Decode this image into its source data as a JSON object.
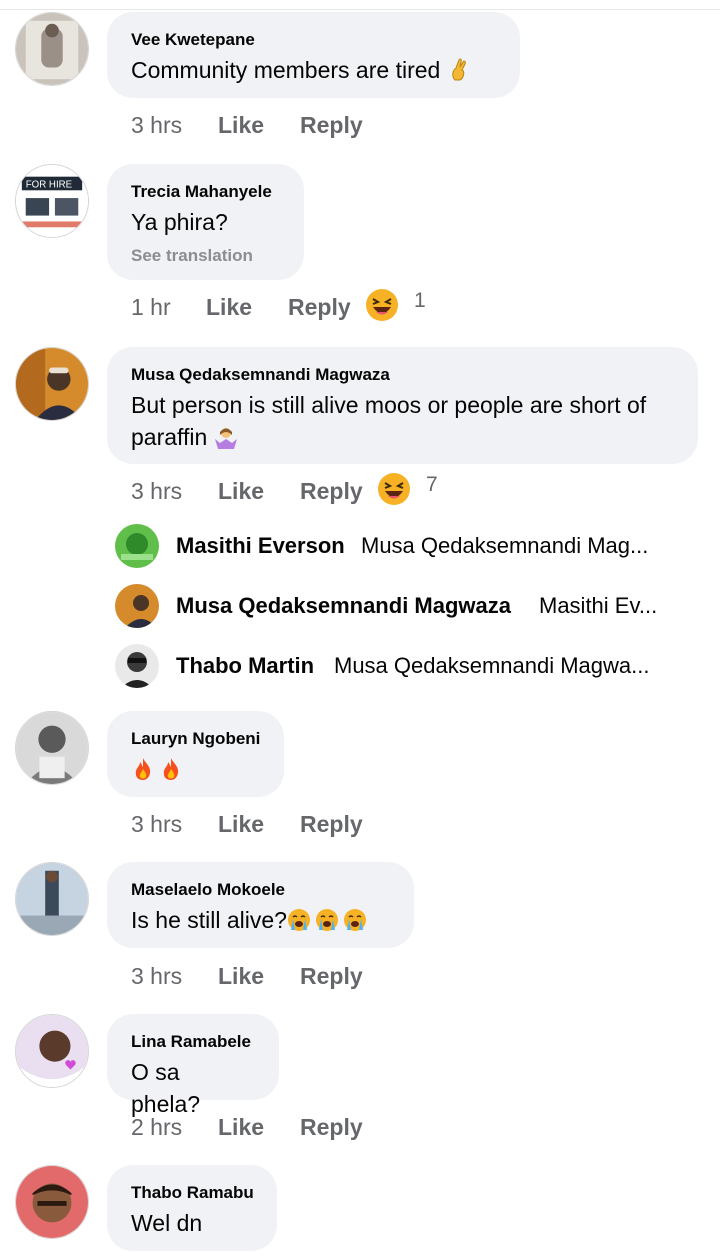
{
  "comments": [
    {
      "author": "Vee Kwetepane",
      "text": "Community members are tired",
      "time": "3 hrs",
      "like_label": "Like",
      "reply_label": "Reply"
    },
    {
      "author": "Trecia Mahanyele",
      "text": "Ya phira?",
      "see_translation": "See translation",
      "time": "1 hr",
      "like_label": "Like",
      "reply_label": "Reply",
      "reaction_count": "1"
    },
    {
      "author": "Musa Qedaksemnandi Magwaza",
      "text_line1": "But person is still alive moos or people are short of",
      "text_line2": "paraffin",
      "time": "3 hrs",
      "like_label": "Like",
      "reply_label": "Reply",
      "reaction_count": "7",
      "replies": [
        {
          "name": "Masithi Everson",
          "text": "Musa Qedaksemnandi Mag..."
        },
        {
          "name": "Musa Qedaksemnandi Magwaza",
          "text": "Masithi Ev..."
        },
        {
          "name": "Thabo Martin",
          "text": "Musa Qedaksemnandi Magwa..."
        }
      ]
    },
    {
      "author": "Lauryn Ngobeni",
      "time": "3 hrs",
      "like_label": "Like",
      "reply_label": "Reply"
    },
    {
      "author": "Maselaelo Mokoele",
      "text": "Is he still alive?",
      "time": "3 hrs",
      "like_label": "Like",
      "reply_label": "Reply"
    },
    {
      "author": "Lina Ramabele",
      "text": "O sa phela?",
      "time": "2 hrs",
      "like_label": "Like",
      "reply_label": "Reply"
    },
    {
      "author": "Thabo Ramabu",
      "text": "Wel dn"
    }
  ],
  "colors": {
    "bubble": "#f0f2f5",
    "meta_text": "#65676b",
    "translation": "#8a8d91"
  },
  "icons": [
    "crossed-fingers-emoji",
    "laughing-emoji",
    "woman-shrugging-emoji",
    "fire-emoji",
    "crying-emoji",
    "avatar"
  ]
}
